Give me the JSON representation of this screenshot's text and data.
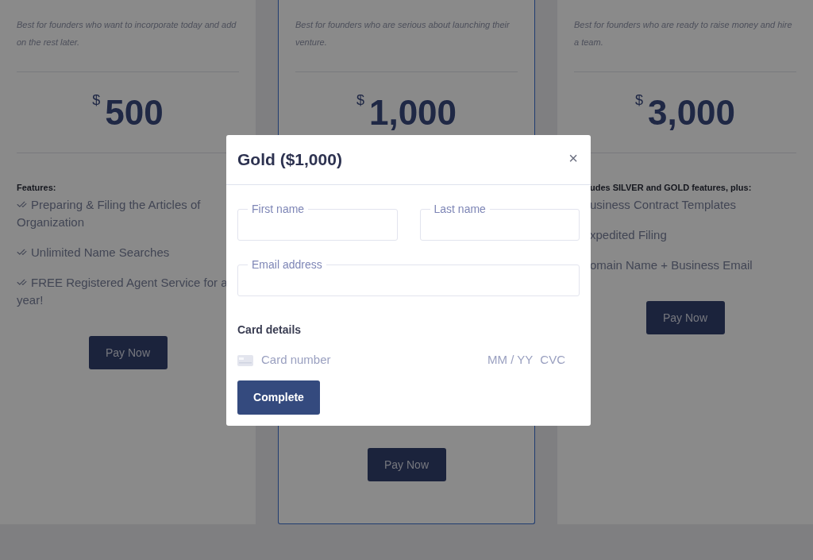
{
  "plans": [
    {
      "description": "Best for founders who want to incorporate today and add on the rest later.",
      "currency": "$",
      "price": "500",
      "selected": false,
      "features_title": "Features:",
      "features": [
        "Preparing & Filing the Articles of Organization",
        "Unlimited Name Searches",
        "FREE Registered Agent Service for a year!"
      ],
      "button": "Pay Now"
    },
    {
      "description": "Best for founders who are serious about launching their venture.",
      "currency": "$",
      "price": "1,000",
      "selected": true,
      "button": "Pay Now"
    },
    {
      "description": "Best for founders who are ready to raise money and hire a team.",
      "currency": "$",
      "price": "3,000",
      "selected": false,
      "features_title": "udes SILVER and GOLD features, plus:",
      "features": [
        "usiness Contract Templates",
        "xpedited Filing",
        "omain Name + Business Email"
      ],
      "button": "Pay Now"
    }
  ],
  "modal": {
    "title": "Gold ($1,000)",
    "close": "×",
    "first_name": {
      "label": "First name"
    },
    "last_name": {
      "label": "Last name"
    },
    "email": {
      "label": "Email address"
    },
    "card_heading": "Card details",
    "card_number": {
      "placeholder": "Card number"
    },
    "expiry": {
      "placeholder": "MM / YY"
    },
    "cvc": {
      "placeholder": "CVC"
    },
    "submit": "Complete"
  }
}
